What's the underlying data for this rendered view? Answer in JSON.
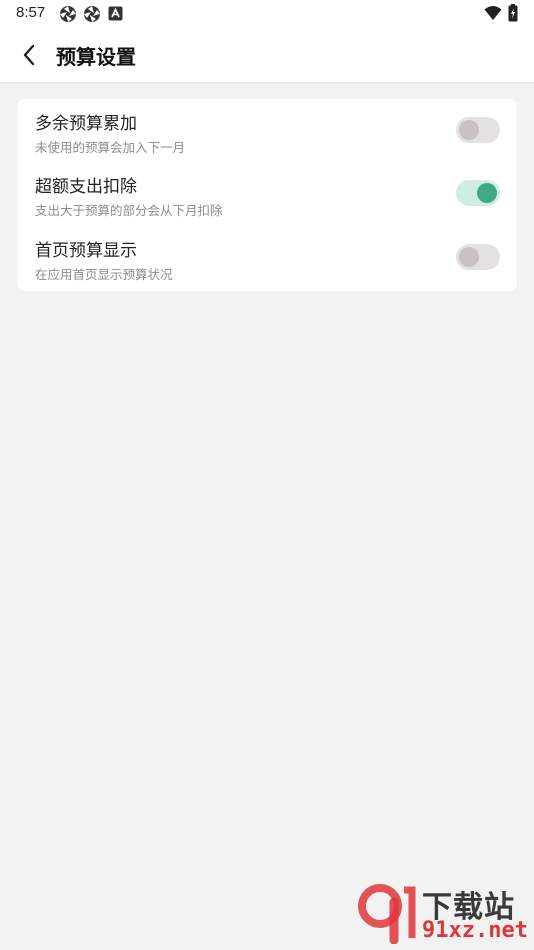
{
  "status_bar": {
    "time": "8:57"
  },
  "header": {
    "title": "预算设置"
  },
  "settings": [
    {
      "title": "多余预算累加",
      "description": "未使用的预算会加入下一月",
      "enabled": false
    },
    {
      "title": "超额支出扣除",
      "description": "支出大于预算的部分会从下月扣除",
      "enabled": true
    },
    {
      "title": "首页预算显示",
      "description": "在应用首页显示预算状况",
      "enabled": false
    }
  ],
  "watermark": {
    "brand": "下载站",
    "url": "91xz.net"
  },
  "colors": {
    "accent": "#3fa886",
    "toggle_on_track": "#cfeee3",
    "toggle_off_track": "#e3e1e2",
    "watermark_red": "#e0363a"
  }
}
